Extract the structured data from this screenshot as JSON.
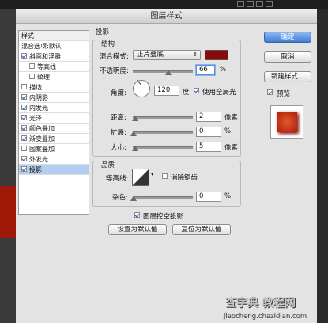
{
  "dialog": {
    "title": "图层样式"
  },
  "sidebar": {
    "header": "样式",
    "items": [
      {
        "label": "混合选项:默认",
        "checkbox": false,
        "checked": false,
        "indent": 0
      },
      {
        "label": "斜面和浮雕",
        "checkbox": true,
        "checked": true,
        "indent": 0
      },
      {
        "label": "等高线",
        "checkbox": true,
        "checked": false,
        "indent": 1
      },
      {
        "label": "纹理",
        "checkbox": true,
        "checked": false,
        "indent": 1
      },
      {
        "label": "描边",
        "checkbox": true,
        "checked": false,
        "indent": 0
      },
      {
        "label": "内阴影",
        "checkbox": true,
        "checked": true,
        "indent": 0
      },
      {
        "label": "内发光",
        "checkbox": true,
        "checked": true,
        "indent": 0
      },
      {
        "label": "光泽",
        "checkbox": true,
        "checked": true,
        "indent": 0
      },
      {
        "label": "颜色叠加",
        "checkbox": true,
        "checked": true,
        "indent": 0
      },
      {
        "label": "渐变叠加",
        "checkbox": true,
        "checked": true,
        "indent": 0
      },
      {
        "label": "图案叠加",
        "checkbox": true,
        "checked": false,
        "indent": 0
      },
      {
        "label": "外发光",
        "checkbox": true,
        "checked": true,
        "indent": 0
      },
      {
        "label": "投影",
        "checkbox": true,
        "checked": true,
        "indent": 0,
        "selected": true
      }
    ]
  },
  "drop_shadow": {
    "title": "投影",
    "structure": {
      "title": "结构",
      "blend_mode_label": "混合模式:",
      "blend_mode_value": "正片叠底",
      "blend_color": "#8a0a0a",
      "opacity_label": "不透明度:",
      "opacity_value": "66",
      "opacity_unit": "%",
      "angle_label": "角度:",
      "angle_value": "120",
      "angle_unit": "度",
      "global_light_label": "使用全局光",
      "global_light_checked": true,
      "distance_label": "距离:",
      "distance_value": "2",
      "distance_unit": "像素",
      "spread_label": "扩展:",
      "spread_value": "0",
      "spread_unit": "%",
      "size_label": "大小:",
      "size_value": "5",
      "size_unit": "像素"
    },
    "quality": {
      "title": "品质",
      "contour_label": "等高线:",
      "antialias_label": "消除锯齿",
      "antialias_checked": false,
      "noise_label": "杂色:",
      "noise_value": "0",
      "noise_unit": "%"
    },
    "knockout_label": "图层挖空投影",
    "knockout_checked": true,
    "make_default_label": "设置为默认值",
    "reset_default_label": "复位为默认值"
  },
  "buttons": {
    "ok": "确定",
    "cancel": "取消",
    "new_style": "新建样式...",
    "preview_label": "预览",
    "preview_checked": true
  },
  "watermark": {
    "line1": "查字典 教程网",
    "line2": "jiaocheng.chazidian.com"
  },
  "colors": {
    "accent": "#3f7fd8",
    "preview_red": "#c0321a",
    "shadow": "#8a0a0a"
  }
}
